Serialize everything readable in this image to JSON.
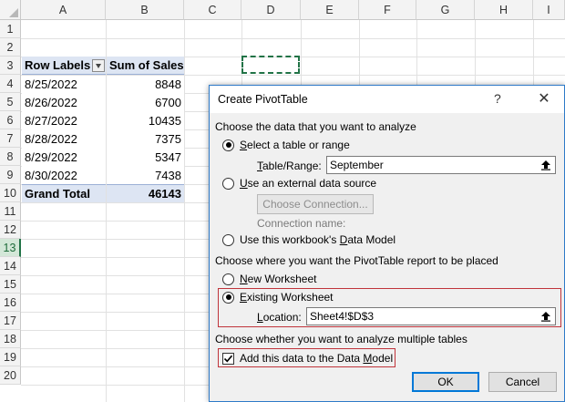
{
  "sheet": {
    "columns": [
      "A",
      "B",
      "C",
      "D",
      "E",
      "F",
      "G",
      "H",
      "I"
    ],
    "rows": [
      "1",
      "2",
      "3",
      "4",
      "5",
      "6",
      "7",
      "8",
      "9",
      "10",
      "11",
      "12",
      "13",
      "14",
      "15",
      "16",
      "17",
      "18",
      "19",
      "20"
    ],
    "active_row": "13",
    "pivot": {
      "header": {
        "row_labels": "Row Labels",
        "sum_of_sales": "Sum of Sales"
      },
      "rows": [
        {
          "label": "8/25/2022",
          "value": "8848"
        },
        {
          "label": "8/26/2022",
          "value": "6700"
        },
        {
          "label": "8/27/2022",
          "value": "10435"
        },
        {
          "label": "8/28/2022",
          "value": "7375"
        },
        {
          "label": "8/29/2022",
          "value": "5347"
        },
        {
          "label": "8/30/2022",
          "value": "7438"
        }
      ],
      "total": {
        "label": "Grand Total",
        "value": "46143"
      }
    }
  },
  "dialog": {
    "title": "Create PivotTable",
    "help": "?",
    "close": "✕",
    "section1": "Choose the data that you want to analyze",
    "opt_table": "elect a table or range",
    "opt_table_key": "S",
    "table_range_label": "able/Range:",
    "table_range_key": "T",
    "table_range_value": "September",
    "opt_external_key": "U",
    "opt_external": "se an external data source",
    "choose_connection": "Choose Connection...",
    "connection_name": "Connection name:",
    "opt_datamodel_pre": "Use this workbook's ",
    "opt_datamodel_key": "D",
    "opt_datamodel_post": "ata Model",
    "section2": "Choose where you want the PivotTable report to be placed",
    "opt_new_key": "N",
    "opt_new": "ew Worksheet",
    "opt_existing_key": "E",
    "opt_existing": "xisting Worksheet",
    "location_key": "L",
    "location_label": "ocation:",
    "location_value": "Sheet4!$D$3",
    "section3": "Choose whether you want to analyze multiple tables",
    "add_datamodel_pre": "Add this data to the Data ",
    "add_datamodel_key": "M",
    "add_datamodel_post": "odel",
    "ok": "OK",
    "cancel": "Cancel"
  },
  "colors": {
    "excel_green": "#217346",
    "pivot_header_bg": "#dde5f3",
    "highlight_red": "#c0343b",
    "dialog_bg": "#f0f0f0"
  }
}
